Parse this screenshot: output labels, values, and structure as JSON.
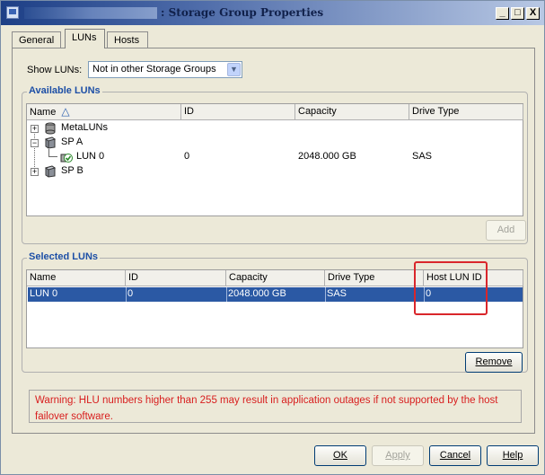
{
  "window": {
    "title": ": Storage Group Properties",
    "minimize_glyph": "_",
    "maximize_glyph": "□",
    "close_glyph": "X"
  },
  "tabs": [
    {
      "label": "General",
      "active": false
    },
    {
      "label": "LUNs",
      "active": true
    },
    {
      "label": "Hosts",
      "active": false
    }
  ],
  "show_luns": {
    "label": "Show LUNs:",
    "selected": "Not in other Storage Groups"
  },
  "available": {
    "legend": "Available LUNs",
    "columns": [
      "Name",
      "ID",
      "Capacity",
      "Drive Type"
    ],
    "sort_glyph": "△",
    "tree": [
      {
        "name": "MetaLUNs",
        "id": "",
        "capacity": "",
        "drive_type": "",
        "expander": "+"
      },
      {
        "name": "SP A",
        "id": "",
        "capacity": "",
        "drive_type": "",
        "expander": "−"
      },
      {
        "name": "LUN 0",
        "id": "0",
        "capacity": "2048.000 GB",
        "drive_type": "SAS",
        "expander": ""
      },
      {
        "name": "SP B",
        "id": "",
        "capacity": "",
        "drive_type": "",
        "expander": "+"
      }
    ],
    "add_label": "Add"
  },
  "selected": {
    "legend": "Selected LUNs",
    "columns": [
      "Name",
      "ID",
      "Capacity",
      "Drive Type",
      "Host LUN ID"
    ],
    "rows": [
      {
        "name": "LUN 0",
        "id": "0",
        "capacity": "2048.000 GB",
        "drive_type": "SAS",
        "host_lun_id": "0"
      }
    ],
    "remove_label": "Remove"
  },
  "warning": "Warning: HLU numbers higher than 255 may result in application outages if not supported by the host failover software.",
  "footer": {
    "ok": "OK",
    "apply": "Apply",
    "cancel": "Cancel",
    "help": "Help"
  },
  "colors": {
    "legend_blue": "#1d4fa6",
    "selection": "#2b59a4",
    "warning_red": "#d81e1e",
    "highlight_red": "#d9262b"
  },
  "icons": {
    "metaluns": "database-icon",
    "sp": "storage-processor-icon",
    "lun": "lun-check-icon",
    "sort": "sort-ascending-icon"
  }
}
